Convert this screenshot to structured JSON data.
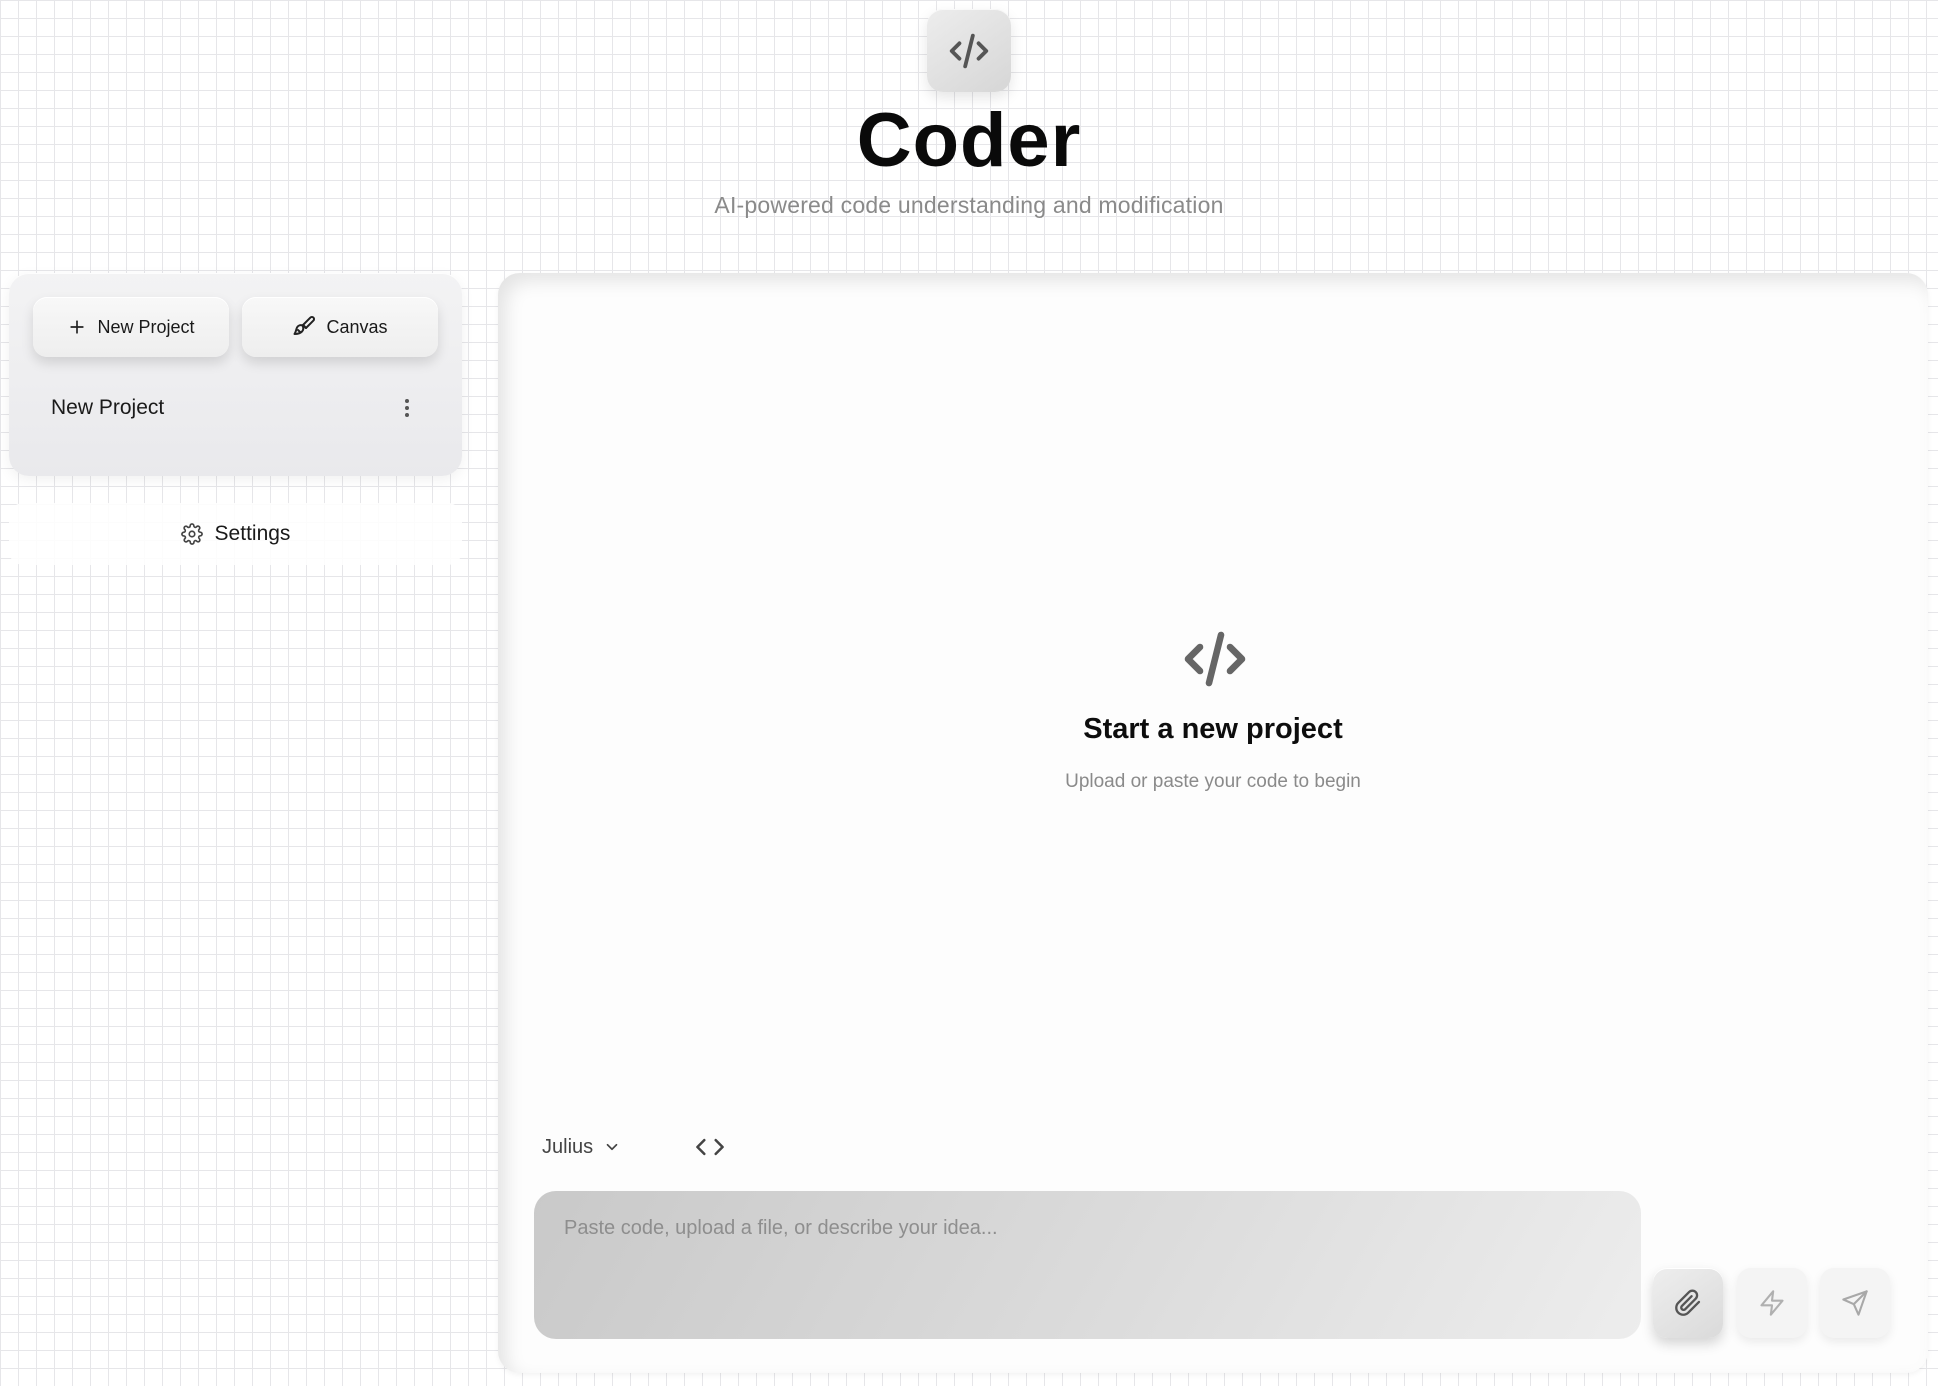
{
  "header": {
    "title": "Coder",
    "subtitle": "AI-powered code understanding and modification",
    "logo_icon": "code-icon"
  },
  "sidebar": {
    "new_project_label": "New Project",
    "canvas_label": "Canvas",
    "projects": [
      {
        "name": "New Project"
      }
    ],
    "settings_label": "Settings"
  },
  "main": {
    "empty_state": {
      "icon": "code-icon",
      "title": "Start a new project",
      "subtitle": "Upload or paste your code to begin"
    },
    "model_selector": {
      "value": "Julius"
    },
    "prompt": {
      "placeholder": "Paste code, upload a file, or describe your idea...",
      "value": ""
    },
    "actions": {
      "attach_icon": "paperclip-icon",
      "flash_icon": "lightning-icon",
      "send_icon": "send-icon"
    }
  },
  "colors": {
    "title": "#0a0a0a",
    "muted_text": "#8a8a8a",
    "grid_line": "#e6e6e9",
    "panel_bg": "#fdfdfd"
  }
}
